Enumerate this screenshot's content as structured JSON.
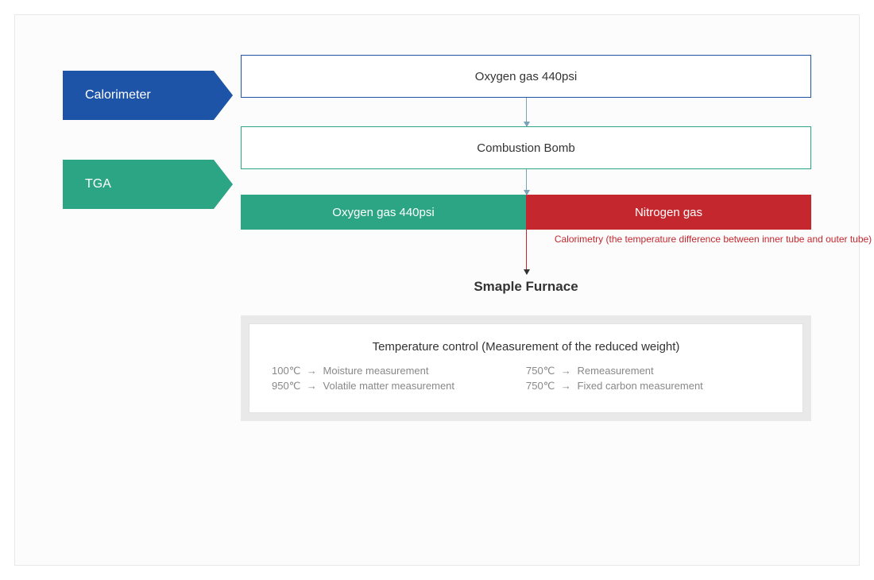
{
  "tags": {
    "calorimeter": "Calorimeter",
    "tga": "TGA"
  },
  "boxes": {
    "oxygen_top": "Oxygen gas 440psi",
    "combustion": "Combustion Bomb",
    "oxygen_split": "Oxygen gas 440psi",
    "nitrogen_split": "Nitrogen gas"
  },
  "calorimetry_note": "Calorimetry (the temperature difference between inner tube and outer tube)",
  "sample_furnace": "Smaple Furnace",
  "temperature": {
    "title": "Temperature control (Measurement of the reduced weight)",
    "items": [
      {
        "temp": "100℃",
        "desc": "Moisture measurement"
      },
      {
        "temp": "950℃",
        "desc": "Volatile matter measurement"
      },
      {
        "temp": "750℃",
        "desc": "Remeasurement"
      },
      {
        "temp": "750℃",
        "desc": "Fixed carbon measurement"
      }
    ]
  }
}
